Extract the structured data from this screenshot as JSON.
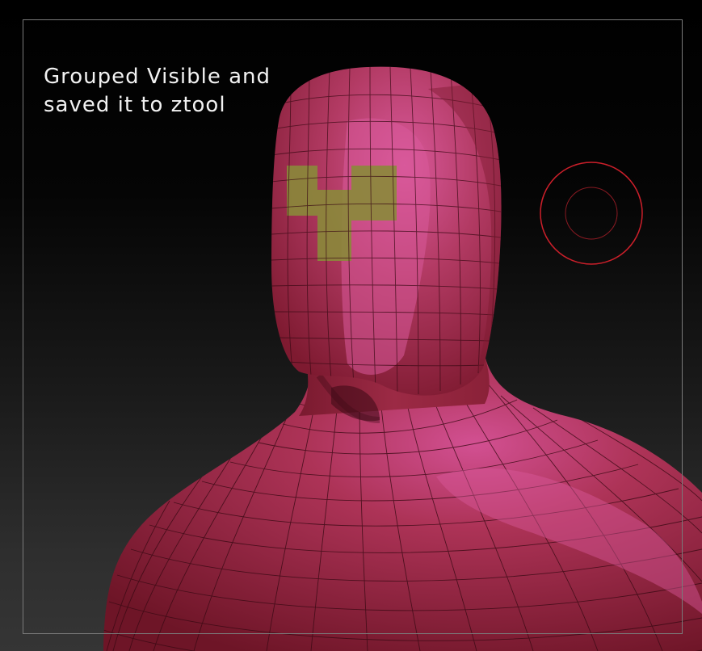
{
  "caption": {
    "line1": "Grouped Visible and",
    "line2": "saved it to ztool"
  },
  "colors": {
    "mesh_base": "#b0324f",
    "mesh_highlight": "#d9599b",
    "mesh_shadow": "#6e1527",
    "polygroup": "#8a8a3a",
    "wire": "#3a0a14",
    "cursor": "#cc1f2a",
    "frame": "#7a7a7a",
    "text": "#f2f2f2"
  },
  "cursor": {
    "icon": "brush-cursor-icon"
  }
}
